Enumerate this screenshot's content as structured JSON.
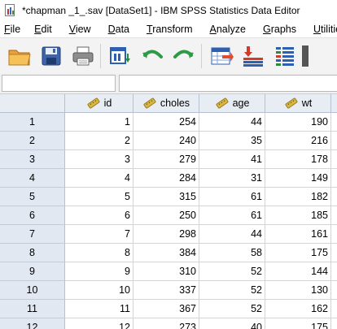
{
  "window": {
    "title": "*chapman _1_.sav [DataSet1] - IBM SPSS Statistics Data Editor"
  },
  "menu": [
    {
      "label": "File",
      "u": "F",
      "rest": "ile"
    },
    {
      "label": "Edit",
      "u": "E",
      "rest": "dit"
    },
    {
      "label": "View",
      "u": "V",
      "rest": "iew"
    },
    {
      "label": "Data",
      "u": "D",
      "rest": "ata"
    },
    {
      "label": "Transform",
      "u": "T",
      "rest": "ransform"
    },
    {
      "label": "Analyze",
      "u": "A",
      "rest": "nalyze"
    },
    {
      "label": "Graphs",
      "u": "G",
      "rest": "raphs"
    },
    {
      "label": "Utilities",
      "u": "U",
      "rest": "tilitie"
    }
  ],
  "toolbar": {
    "buttons": [
      "open-folder-icon",
      "save-disk-icon",
      "print-icon",
      "recall-dialog-icon",
      "undo-icon",
      "redo-icon",
      "go-to-case-icon",
      "insert-case-icon",
      "split-file-icon"
    ]
  },
  "refbar": {
    "cell_reference": "",
    "cell_value": ""
  },
  "grid": {
    "columns": [
      {
        "name": "id",
        "icon": "ruler-scale-icon"
      },
      {
        "name": "choles",
        "icon": "ruler-scale-icon"
      },
      {
        "name": "age",
        "icon": "ruler-scale-icon"
      },
      {
        "name": "wt",
        "icon": "ruler-scale-icon"
      }
    ],
    "rows": [
      {
        "n": "1",
        "id": "1",
        "choles": "254",
        "age": "44",
        "wt": "190"
      },
      {
        "n": "2",
        "id": "2",
        "choles": "240",
        "age": "35",
        "wt": "216"
      },
      {
        "n": "3",
        "id": "3",
        "choles": "279",
        "age": "41",
        "wt": "178"
      },
      {
        "n": "4",
        "id": "4",
        "choles": "284",
        "age": "31",
        "wt": "149"
      },
      {
        "n": "5",
        "id": "5",
        "choles": "315",
        "age": "61",
        "wt": "182"
      },
      {
        "n": "6",
        "id": "6",
        "choles": "250",
        "age": "61",
        "wt": "185"
      },
      {
        "n": "7",
        "id": "7",
        "choles": "298",
        "age": "44",
        "wt": "161"
      },
      {
        "n": "8",
        "id": "8",
        "choles": "384",
        "age": "58",
        "wt": "175"
      },
      {
        "n": "9",
        "id": "9",
        "choles": "310",
        "age": "52",
        "wt": "144"
      },
      {
        "n": "10",
        "id": "10",
        "choles": "337",
        "age": "52",
        "wt": "130"
      },
      {
        "n": "11",
        "id": "11",
        "choles": "367",
        "age": "52",
        "wt": "162"
      },
      {
        "n": "12",
        "id": "12",
        "choles": "273",
        "age": "40",
        "wt": "175"
      }
    ]
  }
}
